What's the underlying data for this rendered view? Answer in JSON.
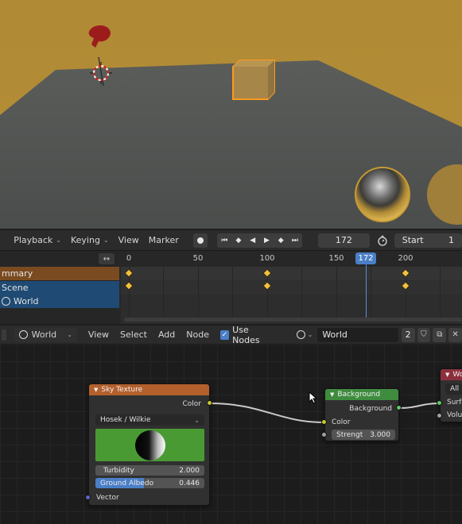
{
  "timeline": {
    "menus": [
      {
        "label": "Playback",
        "icon": "chevron-down-icon"
      },
      {
        "label": "Keying",
        "icon": "chevron-down-icon"
      },
      {
        "label": "View"
      },
      {
        "label": "Marker"
      }
    ],
    "current_frame": "172",
    "start_label": "Start",
    "start_value": "1",
    "ruler_ticks": [
      "0",
      "50",
      "100",
      "150",
      "200"
    ],
    "ruler_current": "172",
    "channels": [
      "mmary",
      "Scene",
      "World"
    ]
  },
  "node_editor": {
    "world_selector": "World",
    "menus": [
      "View",
      "Select",
      "Add",
      "Node"
    ],
    "use_nodes_label": "Use Nodes",
    "use_nodes_checked": true,
    "world_name": "World",
    "users_count": "2",
    "nodes": {
      "sky_texture": {
        "title": "Sky Texture",
        "output_color": "Color",
        "sky_type": "Hosek / Wilkie",
        "turbidity_label": "Turbidity",
        "turbidity_value": "2.000",
        "albedo_label": "Ground Albedo",
        "albedo_value": "0.446",
        "albedo_fill": 0.446,
        "vector_label": "Vector"
      },
      "background": {
        "title": "Background",
        "output_label": "Background",
        "color_label": "Color",
        "strength_label": "Strengt",
        "strength_value": "3.000"
      },
      "world_output": {
        "title": "Wo",
        "target": "All",
        "surface_label": "Surfa",
        "volume_label": "Volum"
      }
    }
  },
  "colors": {
    "sky_header": "#b3602d",
    "background_header": "#3f8c3f",
    "output_header": "#8c2f3d",
    "selection": "#4a7fc8",
    "keyframe": "#f2c13b"
  }
}
